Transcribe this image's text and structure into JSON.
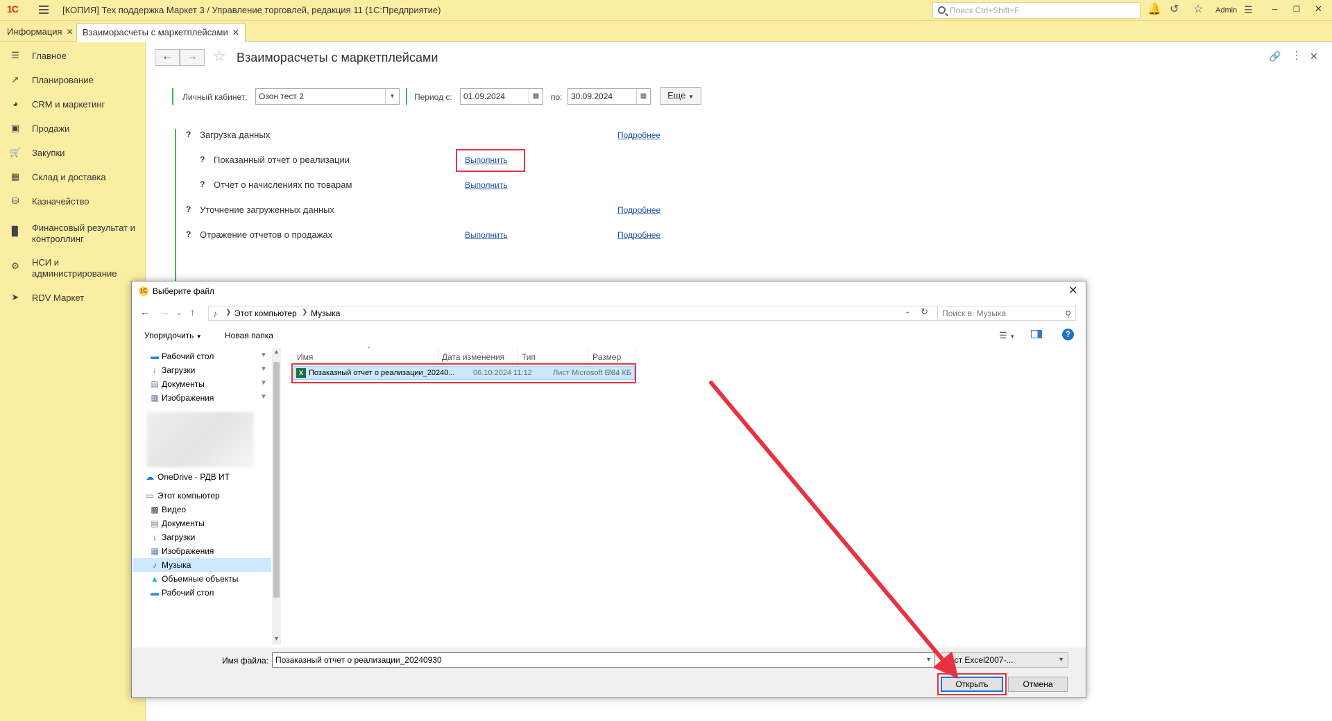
{
  "app": {
    "logo": "1С",
    "title": "[КОПИЯ] Тех поддержка Маркет 3 / Управление торговлей, редакция 11  (1С:Предприятие)",
    "search_placeholder": "Поиск Ctrl+Shift+F",
    "user": "Admin"
  },
  "tabs": [
    {
      "label": "Информация"
    },
    {
      "label": "Взаиморасчеты с маркетплейсами"
    }
  ],
  "sidebar": {
    "items": [
      {
        "label": "Главное",
        "icon": "menu-icon"
      },
      {
        "label": "Планирование",
        "icon": "chart-up-icon"
      },
      {
        "label": "CRM и маркетинг",
        "icon": "pie-chart-icon"
      },
      {
        "label": "Продажи",
        "icon": "shopping-bag-icon"
      },
      {
        "label": "Закупки",
        "icon": "cart-icon"
      },
      {
        "label": "Склад и доставка",
        "icon": "warehouse-icon"
      },
      {
        "label": "Казначейство",
        "icon": "coins-icon"
      },
      {
        "label": "Финансовый результат и контроллинг",
        "icon": "bar-chart-icon"
      },
      {
        "label": "НСИ и администрирование",
        "icon": "gear-icon"
      },
      {
        "label": "RDV Маркет",
        "icon": "rocket-icon"
      }
    ]
  },
  "form": {
    "title": "Взаиморасчеты с маркетплейсами",
    "cabinet_label": "Личный кабинет:",
    "cabinet_value": "Озон тест 2",
    "period_from_label": "Период с:",
    "period_from": "01.09.2024",
    "period_to_label": "по:",
    "period_to": "30.09.2024",
    "more_label": "Еще",
    "steps": [
      {
        "mark": "?",
        "label": "Загрузка данных",
        "link": "",
        "details": "Подробнее"
      },
      {
        "mark": "?",
        "label": "Показанный отчет о реализации",
        "link": "Выполнить",
        "details": ""
      },
      {
        "mark": "?",
        "label": "Отчет о начислениях по товарам",
        "link": "Выполнить",
        "details": ""
      },
      {
        "mark": "?",
        "label": "Уточнение загруженных данных",
        "link": "",
        "details": "Подробнее"
      },
      {
        "mark": "?",
        "label": "Отражение отчетов о продажах",
        "link": "Выполнить",
        "details": "Подробнее"
      }
    ]
  },
  "dialog": {
    "title": "Выберите файл",
    "breadcrumb": [
      "Этот компьютер",
      "Музыка"
    ],
    "search_placeholder": "Поиск в: Музыка",
    "organize_label": "Упорядочить",
    "new_folder_label": "Новая папка",
    "nav_items": [
      {
        "label": "Рабочий стол",
        "icon": "desktop-folder-icon",
        "pinned": true
      },
      {
        "label": "Загрузки",
        "icon": "download-folder-icon",
        "pinned": true
      },
      {
        "label": "Документы",
        "icon": "documents-folder-icon",
        "pinned": true
      },
      {
        "label": "Изображения",
        "icon": "pictures-folder-icon",
        "pinned": true
      },
      {
        "label": "OneDrive - РДВ ИТ",
        "icon": "cloud-icon",
        "pinned": false
      },
      {
        "label": "Этот компьютер",
        "icon": "computer-icon",
        "pinned": false
      },
      {
        "label": "Видео",
        "icon": "video-folder-icon",
        "pinned": false
      },
      {
        "label": "Документы",
        "icon": "documents-folder-icon",
        "pinned": false
      },
      {
        "label": "Загрузки",
        "icon": "download-folder-icon",
        "pinned": false
      },
      {
        "label": "Изображения",
        "icon": "pictures-folder-icon",
        "pinned": false
      },
      {
        "label": "Музыка",
        "icon": "music-folder-icon",
        "pinned": false
      },
      {
        "label": "Объемные объекты",
        "icon": "3d-objects-icon",
        "pinned": false
      },
      {
        "label": "Рабочий стол",
        "icon": "desktop-folder-icon",
        "pinned": false
      }
    ],
    "columns": [
      "Имя",
      "Дата изменения",
      "Тип",
      "Размер"
    ],
    "files": [
      {
        "name": "Позаказный отчет о реализации_20240...",
        "modified": "06.10.2024 11:12",
        "type": "Лист Microsoft Ex...",
        "size": "734 КБ"
      }
    ],
    "filename_label": "Имя файла:",
    "filename_value": "Позаказный отчет о реализации_20240930",
    "filetype_value": "Лист Excel2007-...",
    "open_label": "Открыть",
    "cancel_label": "Отмена"
  },
  "colors": {
    "panel_yellow": "#fbeda2",
    "highlight_red": "#e8323f",
    "link_blue": "#1e55a4",
    "selection_blue": "#cce8ff",
    "accent_green": "#4caf50"
  }
}
